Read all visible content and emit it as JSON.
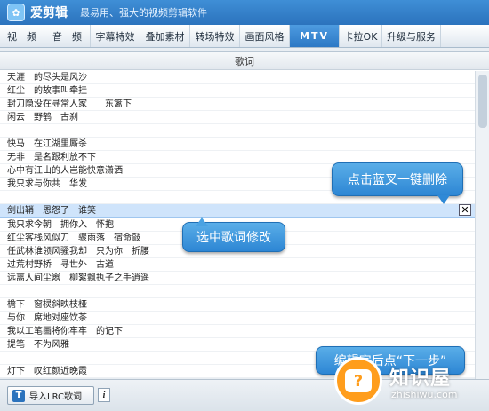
{
  "app": {
    "logo_glyph": "✿",
    "name": "爱剪辑",
    "slogan": "最易用、强大的视频剪辑软件"
  },
  "menu": [
    {
      "label": "视　频",
      "name": "menu-video"
    },
    {
      "label": "音　频",
      "name": "menu-audio"
    },
    {
      "label": "字幕特效",
      "name": "menu-subtitle-effects"
    },
    {
      "label": "叠加素材",
      "name": "menu-overlay"
    },
    {
      "label": "转场特效",
      "name": "menu-transition"
    },
    {
      "label": "画面风格",
      "name": "menu-picture-style"
    },
    {
      "label": "MTV",
      "name": "menu-mtv"
    },
    {
      "label": "卡拉OK",
      "name": "menu-karaoke"
    },
    {
      "label": "升级与服务",
      "name": "menu-upgrade"
    }
  ],
  "active_menu": "MTV",
  "panel": {
    "header": "歌词"
  },
  "lyrics": [
    "天涯　的尽头是风沙",
    "红尘　的故事叫牵挂",
    "封刀隐没在寻常人家　　东篱下",
    "闲云　野鹤　古刹",
    "",
    "快马　在江湖里厮杀",
    "无非　是名跟利放不下",
    "心中有江山的人岂能快意潇洒",
    "我只求与你共　华发",
    "",
    "剑出鞘　恩怨了　谁笑",
    "我只求今朝　拥你入　怀抱",
    "红尘客栈风似刀　骤雨落　宿命敲",
    "任武林谁领风骚我却　只为你　折腰",
    "过荒村野桥　寻世外　古道",
    "远离人间尘嚣　柳絮飘执子之手逍遥",
    "",
    "檐下　窗棂斜映枝桠",
    "与你　席地对座饮茶",
    "我以工笔画将你牢牢　的记下",
    "提笔　不为风雅",
    "",
    "灯下　叹红颜近晚霞"
  ],
  "selected_line_index": 10,
  "delete_button": {
    "glyph": "✕"
  },
  "callouts": {
    "delete_hint": "点击蓝叉一键删除",
    "edit_hint": "选中歌词修改",
    "next_hint": "编辑完后点“下一步”"
  },
  "bottom": {
    "import_icon": "T",
    "import_label": "导入LRC歌词",
    "info_glyph": "i"
  },
  "watermark": {
    "title": "知识屋",
    "subtitle": "zhishiwu.com",
    "glyph": "?"
  },
  "colors": {
    "accent": "#2c78c5",
    "selected_row": "#cfe4fb",
    "callout": "#3f98dc",
    "watermark_orange": "#ff9d1c"
  }
}
